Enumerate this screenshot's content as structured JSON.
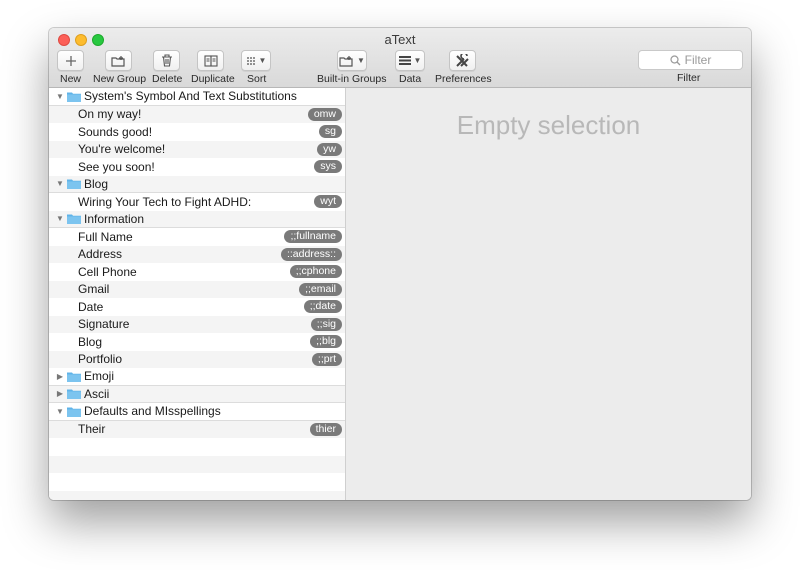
{
  "window": {
    "title": "aText"
  },
  "toolbar": {
    "new_label": "New",
    "new_group_label": "New Group",
    "delete_label": "Delete",
    "duplicate_label": "Duplicate",
    "sort_label": "Sort",
    "builtin_groups_label": "Built-in Groups",
    "data_label": "Data",
    "preferences_label": "Preferences",
    "filter_label": "Filter"
  },
  "search": {
    "placeholder": "Filter"
  },
  "groups": [
    {
      "name": "System's Symbol And Text Substitutions",
      "expanded": true,
      "items": [
        {
          "name": "On my way!",
          "abbr": "omw"
        },
        {
          "name": "Sounds good!",
          "abbr": "sg"
        },
        {
          "name": "You're welcome!",
          "abbr": "yw"
        },
        {
          "name": "See you soon!",
          "abbr": "sys"
        }
      ]
    },
    {
      "name": "Blog",
      "expanded": true,
      "items": [
        {
          "name": "Wiring Your Tech to Fight ADHD:",
          "abbr": "wyt"
        }
      ]
    },
    {
      "name": "Information",
      "expanded": true,
      "items": [
        {
          "name": "Full Name",
          "abbr": ";;fullname"
        },
        {
          "name": "Address",
          "abbr": "::address::"
        },
        {
          "name": "Cell Phone",
          "abbr": ";;cphone"
        },
        {
          "name": "Gmail",
          "abbr": ";;email"
        },
        {
          "name": "Date",
          "abbr": ";;date"
        },
        {
          "name": "Signature",
          "abbr": ";;sig"
        },
        {
          "name": "Blog",
          "abbr": ";;blg"
        },
        {
          "name": "Portfolio",
          "abbr": ";;prt"
        }
      ]
    },
    {
      "name": "Emoji",
      "expanded": false,
      "items": []
    },
    {
      "name": "Ascii",
      "expanded": false,
      "items": []
    },
    {
      "name": "Defaults and MIsspellings",
      "expanded": true,
      "items": [
        {
          "name": "Their",
          "abbr": "thier"
        }
      ]
    }
  ],
  "detail": {
    "empty_text": "Empty selection"
  },
  "colors": {
    "folder": "#5fb3e8",
    "pill": "#7a7a7a",
    "detail_bg": "#ececec"
  },
  "icons": {
    "new": "plus-icon",
    "new_group": "folder-plus-icon",
    "delete": "trash-icon",
    "duplicate": "duplicate-icon",
    "sort": "sort-icon",
    "builtin_groups": "folder-plus-icon",
    "data": "menu-lines-icon",
    "preferences": "tools-icon",
    "search": "search-icon"
  }
}
